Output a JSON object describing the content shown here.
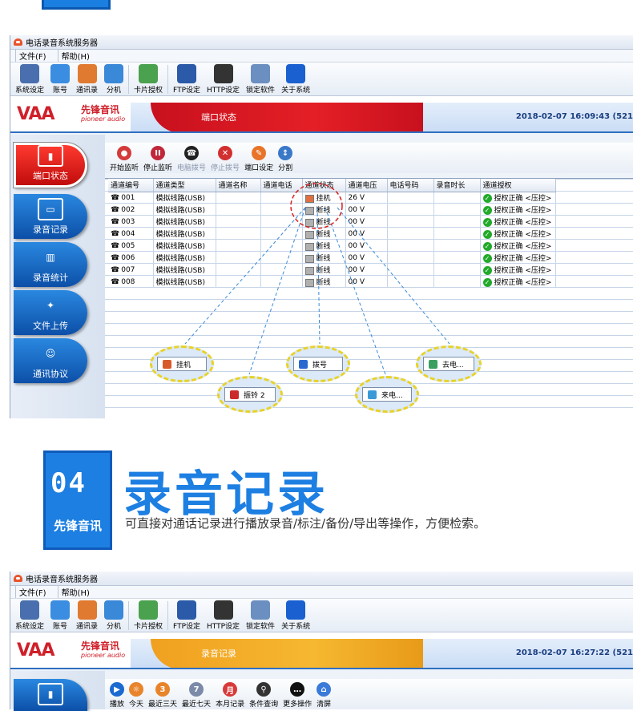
{
  "window": {
    "title": "电话录音系统服务器"
  },
  "menu": [
    "文件(F)",
    "帮助(H)"
  ],
  "toolbar": [
    {
      "label": "系统设定",
      "icon": "gear-icon",
      "color": "#4a6fae"
    },
    {
      "label": "账号",
      "icon": "user-icon",
      "color": "#3a8de0"
    },
    {
      "label": "通讯录",
      "icon": "notebook-icon",
      "color": "#e07a30"
    },
    {
      "label": "分机",
      "icon": "extension-icon",
      "color": "#3a88d8"
    },
    {
      "label": "卡片授权",
      "icon": "card-icon",
      "color": "#4aa14e"
    },
    {
      "label": "FTP设定",
      "icon": "ftp-icon",
      "color": "#2a5aa8"
    },
    {
      "label": "HTTP设定",
      "icon": "http-icon",
      "color": "#333333"
    },
    {
      "label": "锁定软件",
      "icon": "lock-icon",
      "color": "#6b8fc0"
    },
    {
      "label": "关于系统",
      "icon": "info-icon",
      "color": "#1a60d0"
    }
  ],
  "logo": {
    "brand": "VAA",
    "cn": "先锋音讯",
    "en": "pioneer audio"
  },
  "screen1": {
    "title": "端口状态",
    "datetime": "2018-02-07 16:09:43 (521",
    "controls": [
      {
        "label": "开始监听",
        "color": "#d43a3a",
        "glyph": "●",
        "disabled": false
      },
      {
        "label": "停止监听",
        "color": "#c0283a",
        "glyph": "II",
        "disabled": false
      },
      {
        "label": "电脑拨号",
        "color": "#222222",
        "glyph": "☎",
        "disabled": true
      },
      {
        "label": "停止拨号",
        "color": "#d23030",
        "glyph": "✕",
        "disabled": true
      },
      {
        "label": "端口设定",
        "color": "#e8742a",
        "glyph": "✎",
        "disabled": false
      },
      {
        "label": "分割",
        "color": "#3a78c8",
        "glyph": "↕",
        "disabled": false
      }
    ],
    "columns": [
      "通道编号",
      "通道类型",
      "通道名称",
      "通道电话",
      "通道状态",
      "通道电压",
      "电话号码",
      "录音时长",
      "通道授权"
    ],
    "rows": [
      [
        "001",
        "模拟线路(USB)",
        "",
        "",
        "挂机",
        "26 V",
        "",
        "",
        "授权正确 <压控>"
      ],
      [
        "002",
        "模拟线路(USB)",
        "",
        "",
        "断线",
        "00 V",
        "",
        "",
        "授权正确 <压控>"
      ],
      [
        "003",
        "模拟线路(USB)",
        "",
        "",
        "断线",
        "00 V",
        "",
        "",
        "授权正确 <压控>"
      ],
      [
        "004",
        "模拟线路(USB)",
        "",
        "",
        "断线",
        "00 V",
        "",
        "",
        "授权正确 <压控>"
      ],
      [
        "005",
        "模拟线路(USB)",
        "",
        "",
        "断线",
        "00 V",
        "",
        "",
        "授权正确 <压控>"
      ],
      [
        "006",
        "模拟线路(USB)",
        "",
        "",
        "断线",
        "00 V",
        "",
        "",
        "授权正确 <压控>"
      ],
      [
        "007",
        "模拟线路(USB)",
        "",
        "",
        "断线",
        "00 V",
        "",
        "",
        "授权正确 <压控>"
      ],
      [
        "008",
        "模拟线路(USB)",
        "",
        "",
        "断线",
        "00 V",
        "",
        "",
        "授权正确 <压控>"
      ]
    ],
    "legend": [
      {
        "label": "挂机",
        "color": "#d85a2a"
      },
      {
        "label": "振铃 2",
        "color": "#cc2a2a"
      },
      {
        "label": "拨号",
        "color": "#2a6ad0"
      },
      {
        "label": "来电...",
        "color": "#3a9ad8"
      },
      {
        "label": "去电...",
        "color": "#3aa060"
      }
    ]
  },
  "sidebar": [
    "端口状态",
    "录音记录",
    "录音统计",
    "文件上传",
    "通讯协议"
  ],
  "section": {
    "number": "04",
    "badge": "先锋音讯",
    "title": "录音记录",
    "description": "可直接对通话记录进行播放录音/标注/备份/导出等操作，方便检索。"
  },
  "screen2": {
    "title": "录音记录",
    "datetime": "2018-02-07 16:27:22 (521",
    "controls": [
      {
        "label": "播放",
        "color": "#1a6ad0",
        "glyph": "▶"
      },
      {
        "label": "今天",
        "color": "#e8842a",
        "glyph": "☼"
      },
      {
        "label": "最近三天",
        "color": "#e8842a",
        "glyph": "3"
      },
      {
        "label": "最近七天",
        "color": "#7a8aa8",
        "glyph": "7"
      },
      {
        "label": "本月记录",
        "color": "#d83a3a",
        "glyph": "月"
      },
      {
        "label": "条件查询",
        "color": "#333333",
        "glyph": "⚲"
      },
      {
        "label": "更多操作",
        "color": "#111111",
        "glyph": "…"
      },
      {
        "label": "清屏",
        "color": "#3a7ad8",
        "glyph": "⌂"
      }
    ]
  }
}
